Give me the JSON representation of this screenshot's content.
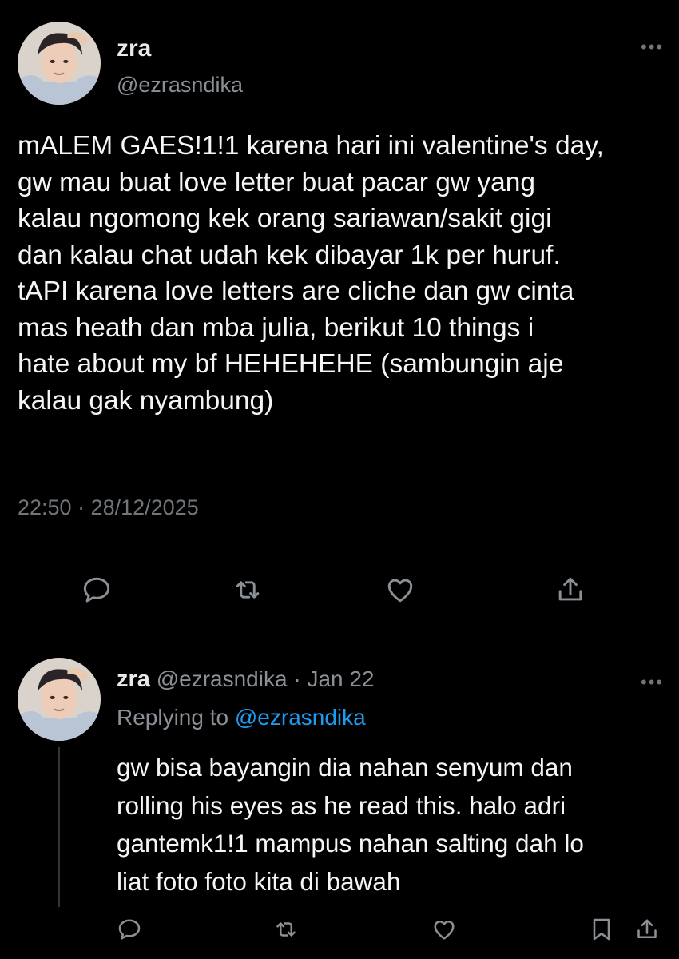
{
  "tweet": {
    "author_name": "zra",
    "author_handle": "@ezrasndika",
    "text": "mALEM GAES!1!1 karena hari ini valentine's day,\ngw mau buat love letter buat pacar gw yang\nkalau ngomong kek orang sariawan/sakit gigi\ndan kalau chat udah kek dibayar 1k per huruf.\ntAPI karena love letters are cliche dan gw cinta\nmas heath dan mba julia, berikut 10 things i\nhate about my bf HEHEHEHE (sambungin aje\nkalau gak nyambung)",
    "timestamp": "22:50 · 28/12/2025",
    "more_icon": "more-horizontal-icon",
    "actions": [
      "reply-icon",
      "retweet-icon",
      "like-icon",
      "share-icon"
    ]
  },
  "reply": {
    "author_name": "zra",
    "author_handle": "@ezrasndika",
    "separator": "·",
    "date": "Jan 22",
    "replying_prefix": "Replying to",
    "replying_handle": "@ezrasndika",
    "text": "gw bisa bayangin dia nahan senyum dan\nrolling his eyes as he read this. halo adri\ngantemk1!1 mampus nahan salting dah lo\nliat foto foto kita di bawah",
    "more_icon": "more-horizontal-icon",
    "actions": [
      "reply-icon",
      "retweet-icon",
      "like-icon",
      "bookmark-icon",
      "share-icon"
    ]
  },
  "colors": {
    "background": "#000000",
    "text_primary": "#e7e9ea",
    "text_secondary": "#71767b",
    "link": "#1d9bf0",
    "divider": "#2f3336"
  }
}
